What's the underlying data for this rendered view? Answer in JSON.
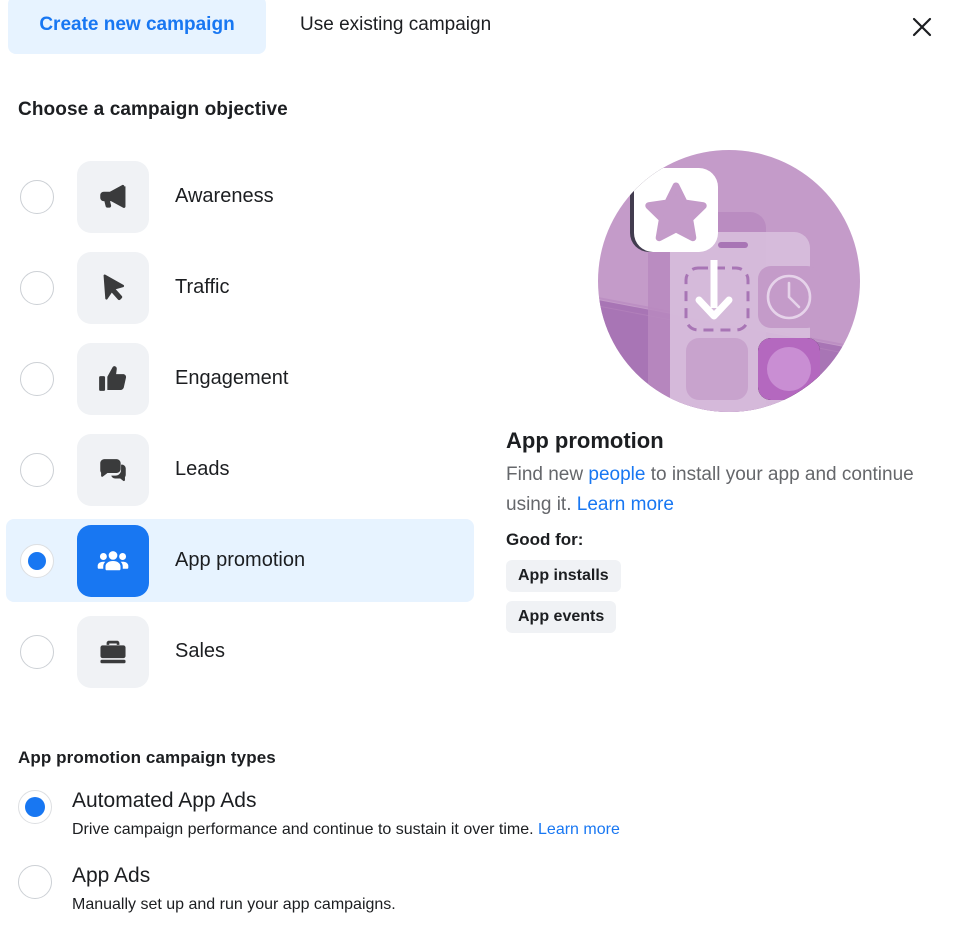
{
  "header": {
    "tabs": [
      {
        "label": "Create new campaign",
        "active": true
      },
      {
        "label": "Use existing campaign",
        "active": false
      }
    ],
    "close_icon": "close-icon"
  },
  "objective_section": {
    "title": "Choose a campaign objective",
    "items": [
      {
        "label": "Awareness",
        "icon": "megaphone-icon",
        "selected": false
      },
      {
        "label": "Traffic",
        "icon": "cursor-icon",
        "selected": false
      },
      {
        "label": "Engagement",
        "icon": "thumbs-up-icon",
        "selected": false
      },
      {
        "label": "Leads",
        "icon": "chat-bubbles-icon",
        "selected": false
      },
      {
        "label": "App promotion",
        "icon": "people-group-icon",
        "selected": true
      },
      {
        "label": "Sales",
        "icon": "briefcase-icon",
        "selected": false
      }
    ]
  },
  "detail": {
    "illustration": "app-promotion-illustration",
    "title": "App promotion",
    "desc_part1": "Find new ",
    "desc_link1": "people",
    "desc_part2": " to install your app and continue using it. ",
    "desc_link2": "Learn more",
    "good_for_label": "Good for:",
    "chips": [
      "App installs",
      "App events"
    ]
  },
  "campaign_types": {
    "title": "App promotion campaign types",
    "options": [
      {
        "name": "Automated App Ads",
        "description": "Drive campaign performance and continue to sustain it over time. ",
        "link": "Learn more",
        "selected": true
      },
      {
        "name": "App Ads",
        "description": "Manually set up and run your app campaigns.",
        "link": "",
        "selected": false
      }
    ]
  },
  "colors": {
    "accent_blue": "#1877f2",
    "selected_row_bg": "#e7f3ff",
    "tile_gray": "#f0f2f5",
    "text_primary": "#1c1e21",
    "text_secondary": "#65676b",
    "illustration_purple_light": "#c49bc9",
    "illustration_purple_dark": "#a875b5"
  }
}
